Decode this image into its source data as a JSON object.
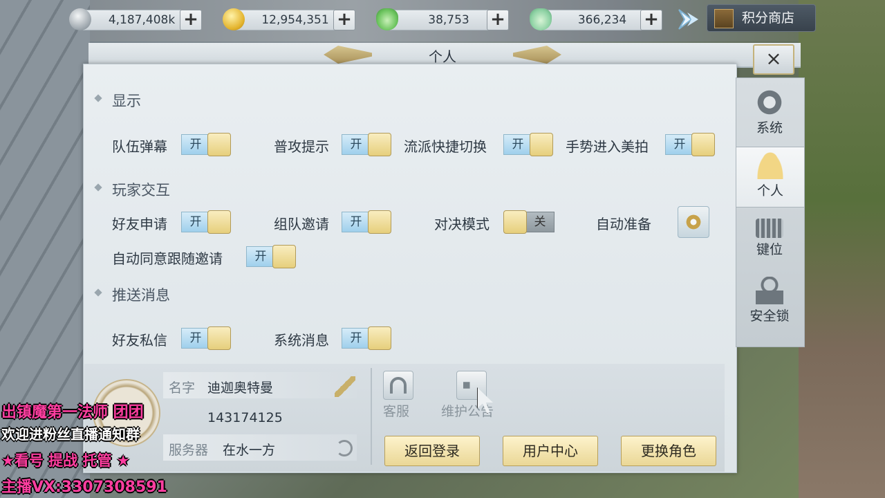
{
  "currencies": [
    {
      "icon": "silver-coin-icon",
      "value": "4,187,408k"
    },
    {
      "icon": "gold-coin-icon",
      "value": "12,954,351"
    },
    {
      "icon": "green-ingot-icon",
      "value": "38,753"
    },
    {
      "icon": "teal-ingot-icon",
      "value": "366,234"
    }
  ],
  "plus_label": "+",
  "shop": {
    "label": "积分商店"
  },
  "window": {
    "title": "个人",
    "close_label": "×"
  },
  "side_tabs": [
    {
      "label": "系统",
      "icon": "gear-icon"
    },
    {
      "label": "个人",
      "icon": "person-icon",
      "active": true
    },
    {
      "label": "键位",
      "icon": "keyboard-icon"
    },
    {
      "label": "安全锁",
      "icon": "lock-icon"
    }
  ],
  "sections": {
    "display": {
      "title": "显示",
      "options": [
        {
          "label": "队伍弹幕",
          "state": "开"
        },
        {
          "label": "普攻提示",
          "state": "开"
        },
        {
          "label": "流派快捷切换",
          "state": "开"
        },
        {
          "label": "手势进入美拍",
          "state": "开"
        }
      ]
    },
    "interaction": {
      "title": "玩家交互",
      "options": [
        {
          "label": "好友申请",
          "state": "开"
        },
        {
          "label": "组队邀请",
          "state": "开"
        },
        {
          "label": "对决模式",
          "state": "关"
        },
        {
          "label": "自动准备"
        },
        {
          "label": "自动同意跟随邀请",
          "state": "开"
        }
      ]
    },
    "push": {
      "title": "推送消息",
      "options": [
        {
          "label": "好友私信",
          "state": "开"
        },
        {
          "label": "系统消息",
          "state": "开"
        }
      ]
    }
  },
  "profile": {
    "name_key": "名字",
    "name_value": "迪迦奥特曼",
    "id_value": "143174125",
    "server_key": "服务器",
    "server_value": "在水一方"
  },
  "links": {
    "service": "客服",
    "notice": "维护公告"
  },
  "actions": {
    "back_login": "返回登录",
    "user_center": "用户中心",
    "switch_role": "更换角色"
  },
  "overlay": {
    "line1": "出镇魔第一法师 团团",
    "line2": "欢迎进粉丝直播通知群",
    "line3": "★看号 提战 托管 ★",
    "line4": "主播VX:3307308591"
  }
}
